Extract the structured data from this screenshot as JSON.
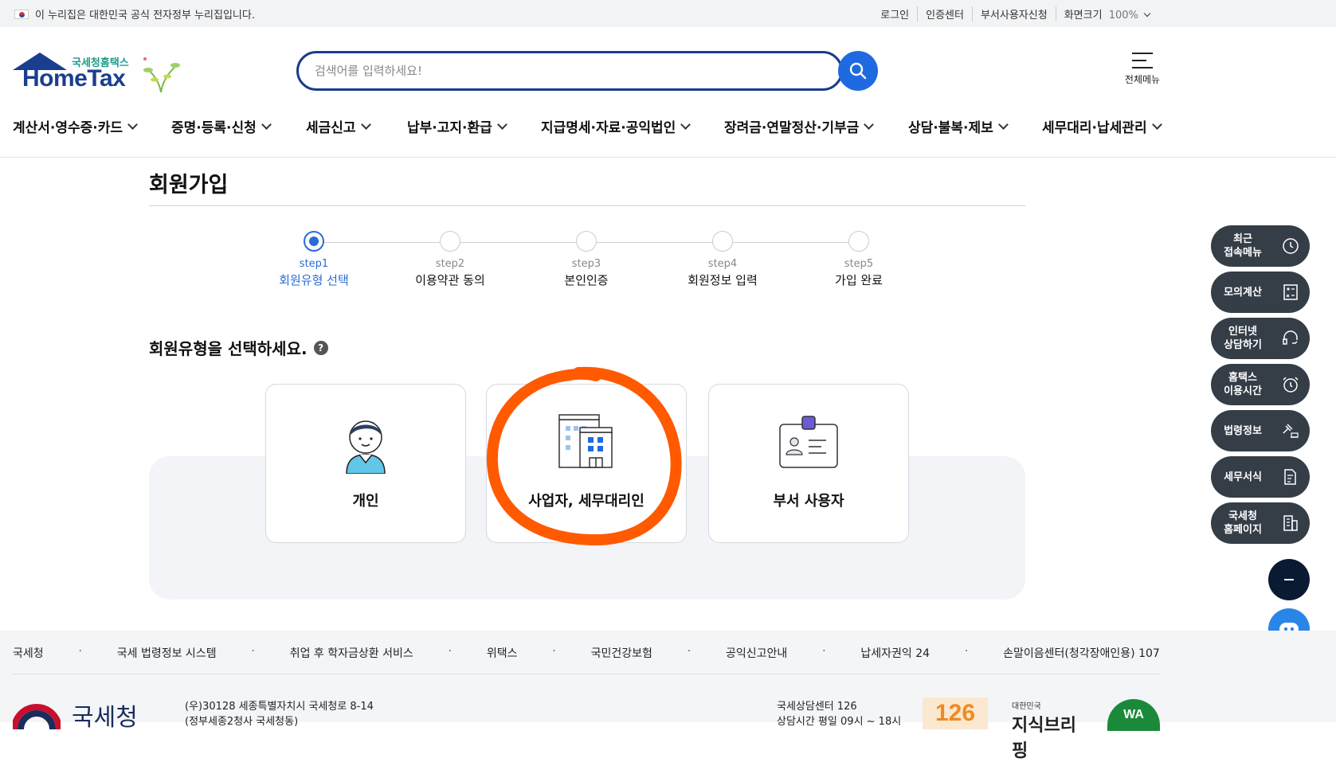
{
  "gov_banner": {
    "text": "이 누리집은 대한민국 공식 전자정부 누리집입니다."
  },
  "util_links": [
    "로그인",
    "인증센터",
    "부서사용자신청",
    "화면크기"
  ],
  "zoom": "100%",
  "logo": {
    "kor": "국세청홈택스",
    "eng": "HomeTax"
  },
  "search": {
    "placeholder": "검색어를 입력하세요!"
  },
  "all_menu_label": "전체메뉴",
  "nav": [
    "계산서·영수증·카드",
    "증명·등록·신청",
    "세금신고",
    "납부·고지·환급",
    "지급명세·자료·공익법인",
    "장려금·연말정산·기부금",
    "상담·불복·제보",
    "세무대리·납세관리"
  ],
  "page_title": "회원가입",
  "steps": [
    {
      "num": "step1",
      "label": "회원유형 선택",
      "active": true
    },
    {
      "num": "step2",
      "label": "이용약관 동의",
      "active": false
    },
    {
      "num": "step3",
      "label": "본인인증",
      "active": false
    },
    {
      "num": "step4",
      "label": "회원정보 입력",
      "active": false
    },
    {
      "num": "step5",
      "label": "가입 완료",
      "active": false
    }
  ],
  "select_title": "회원유형을 선택하세요.",
  "help_mark": "?",
  "cards": [
    {
      "label": "개인",
      "icon": "person-icon"
    },
    {
      "label": "사업자, 세무대리인",
      "icon": "building-icon"
    },
    {
      "label": "부서 사용자",
      "icon": "id-card-icon"
    }
  ],
  "annotation_color": "#ff5a00",
  "quick_menu": [
    {
      "label": "최근\n접속메뉴",
      "icon": "clock-icon"
    },
    {
      "label": "모의계산",
      "icon": "calculator-icon"
    },
    {
      "label": "인터넷\n상담하기",
      "icon": "headset-icon"
    },
    {
      "label": "홈택스\n이용시간",
      "icon": "alarm-icon"
    },
    {
      "label": "법령정보",
      "icon": "gavel-icon"
    },
    {
      "label": "세무서식",
      "icon": "document-icon"
    },
    {
      "label": "국세청\n홈페이지",
      "icon": "office-building-icon"
    }
  ],
  "footer": {
    "links": [
      "국세청",
      "국세 법령정보 시스템",
      "취업 후 학자금상환 서비스",
      "위택스",
      "국민건강보험",
      "공익신고안내",
      "납세자권익 24",
      "손말이음센터(청각장애인용) 107"
    ],
    "org": "국세청",
    "address1": "(우)30128 세종특별자치시 국세청로 8-14",
    "address2": "(정부세종2청사 국세청동)",
    "cs1": "국세상담센터 126",
    "cs2": "상담시간 평일 09시 ~ 18시",
    "badge_126": "126",
    "brand_small": "대한민국",
    "brand_big": "지식브리핑",
    "wa": "WA"
  }
}
